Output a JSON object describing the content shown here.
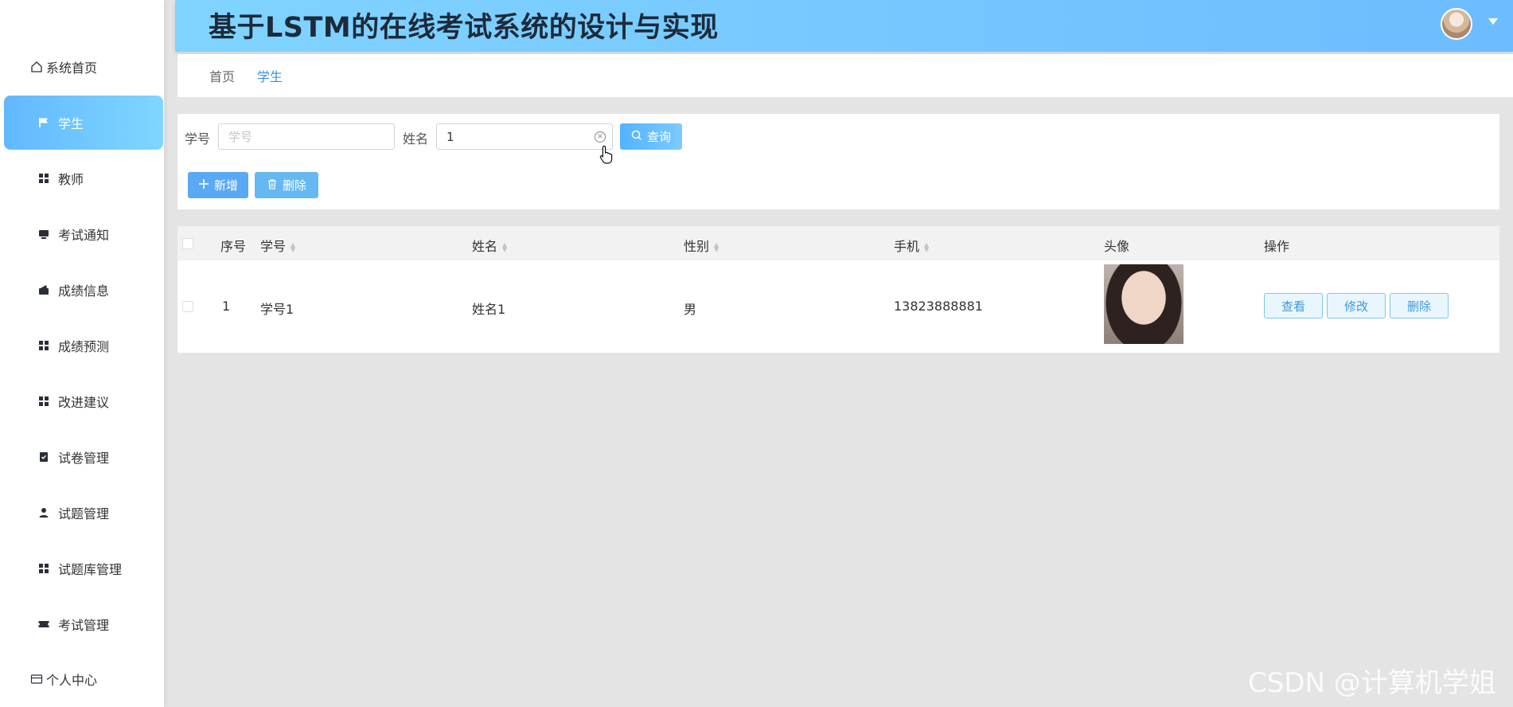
{
  "app": {
    "title": "基于LSTM的在线考试系统的设计与实现"
  },
  "sidebar": {
    "items": [
      {
        "label": "系统首页",
        "icon": "home-icon"
      },
      {
        "label": "学生",
        "icon": "flag-icon",
        "active": true
      },
      {
        "label": "教师",
        "icon": "grid-icon"
      },
      {
        "label": "考试通知",
        "icon": "monitor-icon"
      },
      {
        "label": "成绩信息",
        "icon": "wallet-icon"
      },
      {
        "label": "成绩预测",
        "icon": "grid-icon"
      },
      {
        "label": "改进建议",
        "icon": "grid-icon"
      },
      {
        "label": "试卷管理",
        "icon": "clipboard-check-icon"
      },
      {
        "label": "试题管理",
        "icon": "user-icon"
      },
      {
        "label": "试题库管理",
        "icon": "grid-icon"
      },
      {
        "label": "考试管理",
        "icon": "ticket-icon"
      },
      {
        "label": "个人中心",
        "icon": "card-icon"
      }
    ]
  },
  "breadcrumb": {
    "items": [
      "首页",
      "学生"
    ]
  },
  "search": {
    "student_no_label": "学号",
    "student_no_placeholder": "学号",
    "student_no_value": "",
    "name_label": "姓名",
    "name_value": "1",
    "query_label": "查询",
    "add_label": "新增",
    "delete_label": "删除"
  },
  "table": {
    "columns": [
      "序号",
      "学号",
      "姓名",
      "性别",
      "手机",
      "头像",
      "操作"
    ],
    "rows": [
      {
        "index": "1",
        "student_no": "学号1",
        "name": "姓名1",
        "gender": "男",
        "phone": "13823888881",
        "actions": [
          "查看",
          "修改",
          "删除"
        ]
      }
    ]
  },
  "watermark": "CSDN @计算机学姐",
  "colors": {
    "accent": "#6cbcff",
    "active_nav": "#62b8ff",
    "link": "#3a8ee6"
  }
}
